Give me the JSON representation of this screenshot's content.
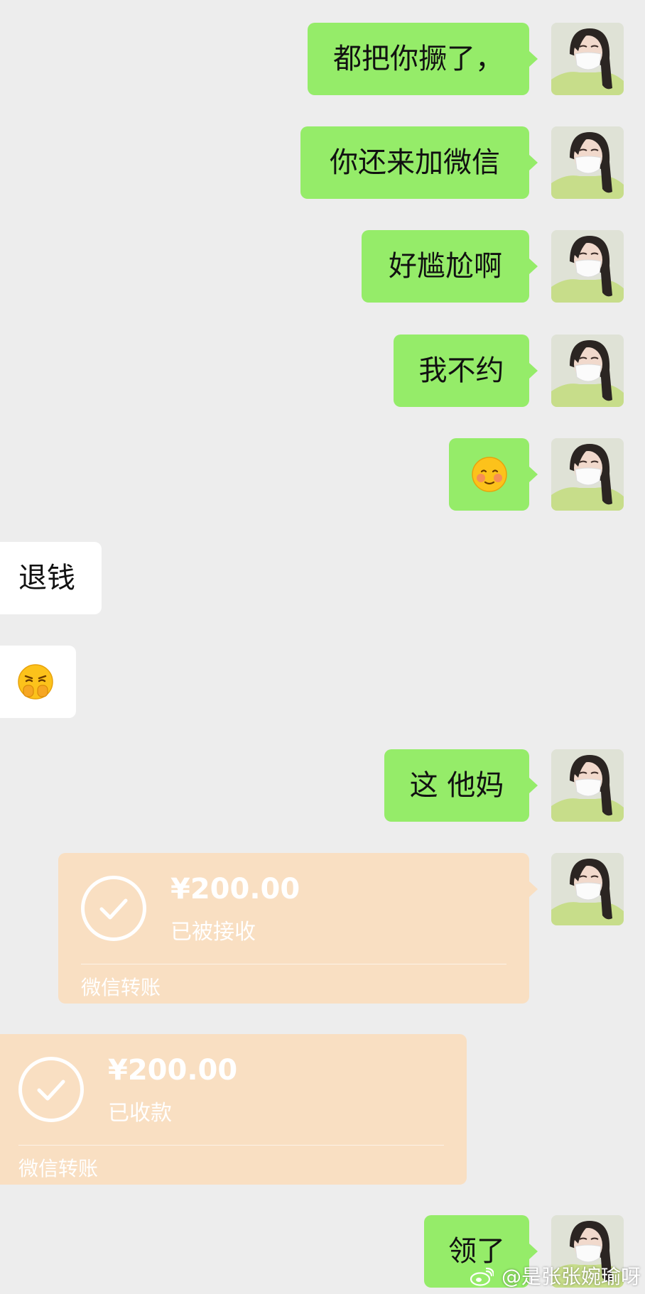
{
  "colors": {
    "background": "#ededed",
    "outgoing_bubble": "#95ec69",
    "incoming_bubble": "#ffffff",
    "transfer_card": "#f9dfc2"
  },
  "messages": [
    {
      "direction": "out",
      "type": "text",
      "text": "都把你撅了，"
    },
    {
      "direction": "out",
      "type": "text",
      "text": "你还来加微信"
    },
    {
      "direction": "out",
      "type": "text",
      "text": "好尴尬啊"
    },
    {
      "direction": "out",
      "type": "text",
      "text": "我不约"
    },
    {
      "direction": "out",
      "type": "emoji",
      "icon": "flushed-face-emoji"
    },
    {
      "direction": "in",
      "type": "text",
      "text": "退钱"
    },
    {
      "direction": "in",
      "type": "emoji",
      "icon": "sneaky-face-emoji"
    },
    {
      "direction": "out",
      "type": "text",
      "text": "这 他妈"
    },
    {
      "direction": "out",
      "type": "transfer",
      "amount": "¥200.00",
      "status": "已被接收",
      "label": "微信转账"
    },
    {
      "direction": "in",
      "type": "transfer",
      "amount": "¥200.00",
      "status": "已收款",
      "label": "微信转账"
    },
    {
      "direction": "out",
      "type": "text",
      "text": "领了"
    }
  ],
  "watermark": {
    "icon": "weibo-icon",
    "text": "@是张张婉瑜呀"
  }
}
